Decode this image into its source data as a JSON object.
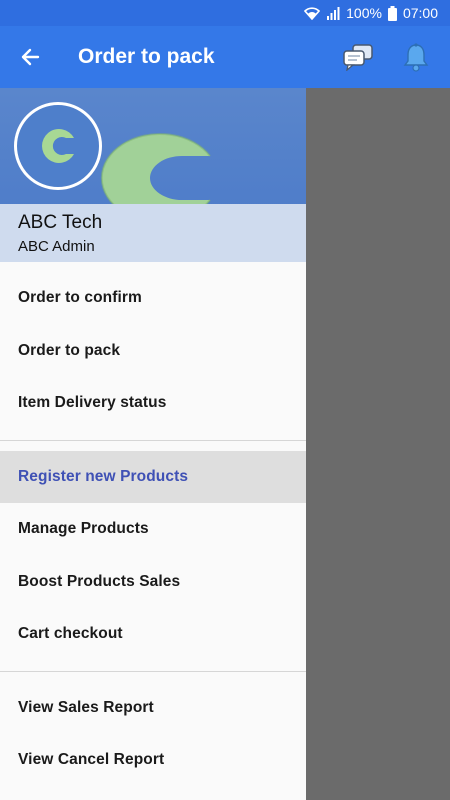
{
  "statusbar": {
    "battery_text": "100%",
    "time": "07:00",
    "icons": [
      "wifi-icon",
      "signal-icon",
      "battery-icon"
    ]
  },
  "appbar": {
    "title": "Order to pack",
    "icons": [
      "back-arrow-icon",
      "chat-icon",
      "bell-icon"
    ]
  },
  "drawer": {
    "avatar_letter": "C",
    "account_name": "ABC Tech",
    "account_role": "ABC Admin",
    "groups": [
      {
        "items": [
          "Order to confirm",
          "Order to pack",
          "Item Delivery status"
        ]
      },
      {
        "items": [
          "Register new Products",
          "Manage Products",
          "Boost Products Sales",
          "Cart checkout"
        ]
      },
      {
        "items": [
          "View Sales Report",
          "View Cancel Report"
        ]
      }
    ],
    "active_item": "Register new Products"
  },
  "colors": {
    "status_bar": "#2f6ee0",
    "app_bar": "#3478e8",
    "header": "#4a79c8",
    "account_bg": "#cfdbee",
    "active_text": "#3f51b5",
    "scrim": "#6b6b6b",
    "logo_green": "#9ed08a"
  }
}
